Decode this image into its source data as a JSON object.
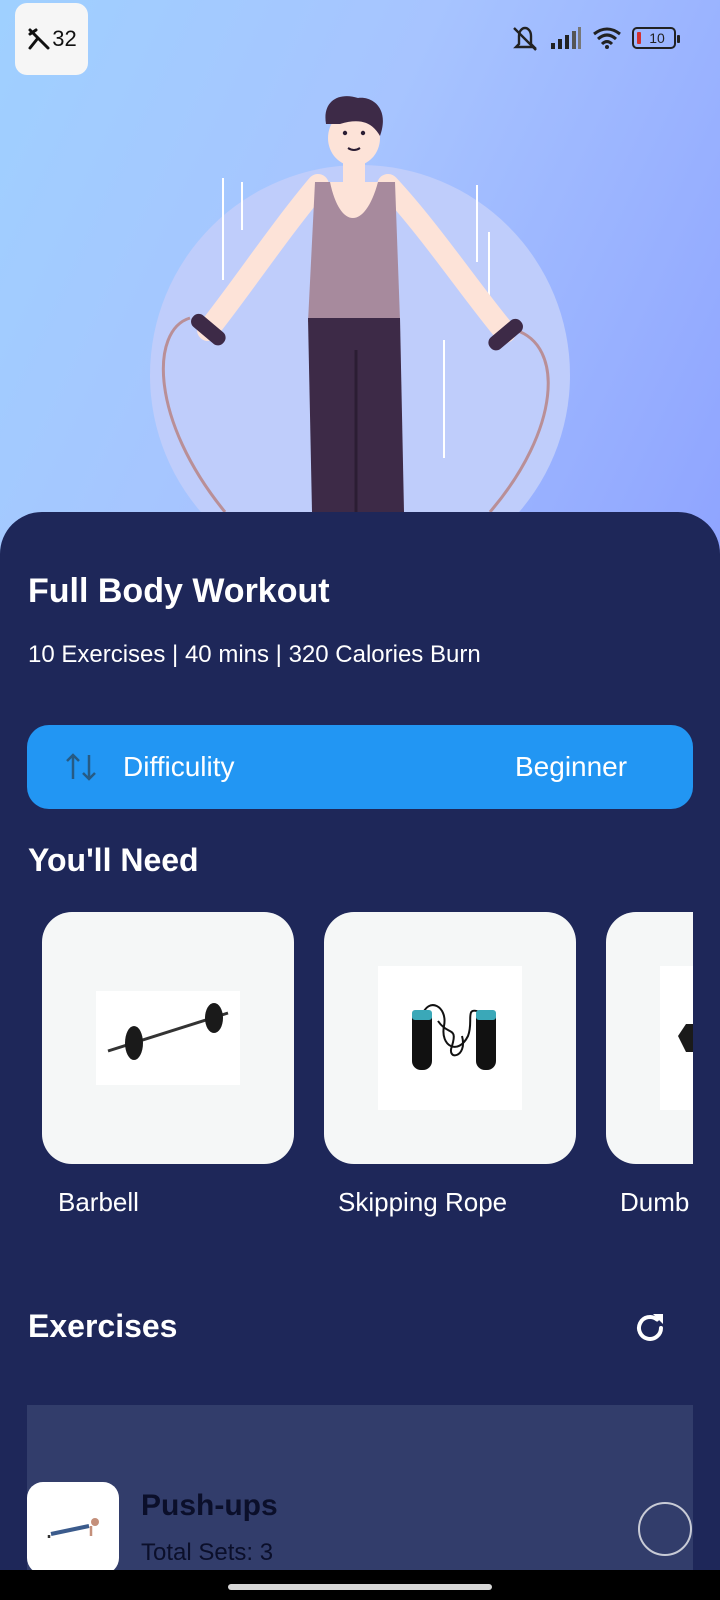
{
  "status_bar": {
    "app_badge_text": "32",
    "battery_level": "10",
    "icons": [
      "mute-icon",
      "signal-icon",
      "wifi-icon",
      "battery-icon"
    ]
  },
  "hero": {
    "illustration": "man-skipping-rope-illustration"
  },
  "workout": {
    "title": "Full Body Workout",
    "summary": "10 Exercises | 40 mins | 320 Calories Burn"
  },
  "difficulty": {
    "label": "Difficulity",
    "value": "Beginner"
  },
  "equipment": {
    "title": "You'll Need",
    "items": [
      {
        "label": "Barbell",
        "image": "barbell-image"
      },
      {
        "label": "Skipping Rope",
        "image": "skipping-rope-image"
      },
      {
        "label": "Dumb",
        "image": "dumbbell-image"
      }
    ]
  },
  "exercises": {
    "title": "Exercises",
    "items": [
      {
        "name": "Push-ups",
        "sets": "Total Sets: 3",
        "image": "push-ups-image"
      }
    ]
  },
  "colors": {
    "sheet_background": "#1e2759",
    "accent": "#2296f3",
    "card": "#f5f7f7",
    "exercise_card": "#323d6b"
  }
}
